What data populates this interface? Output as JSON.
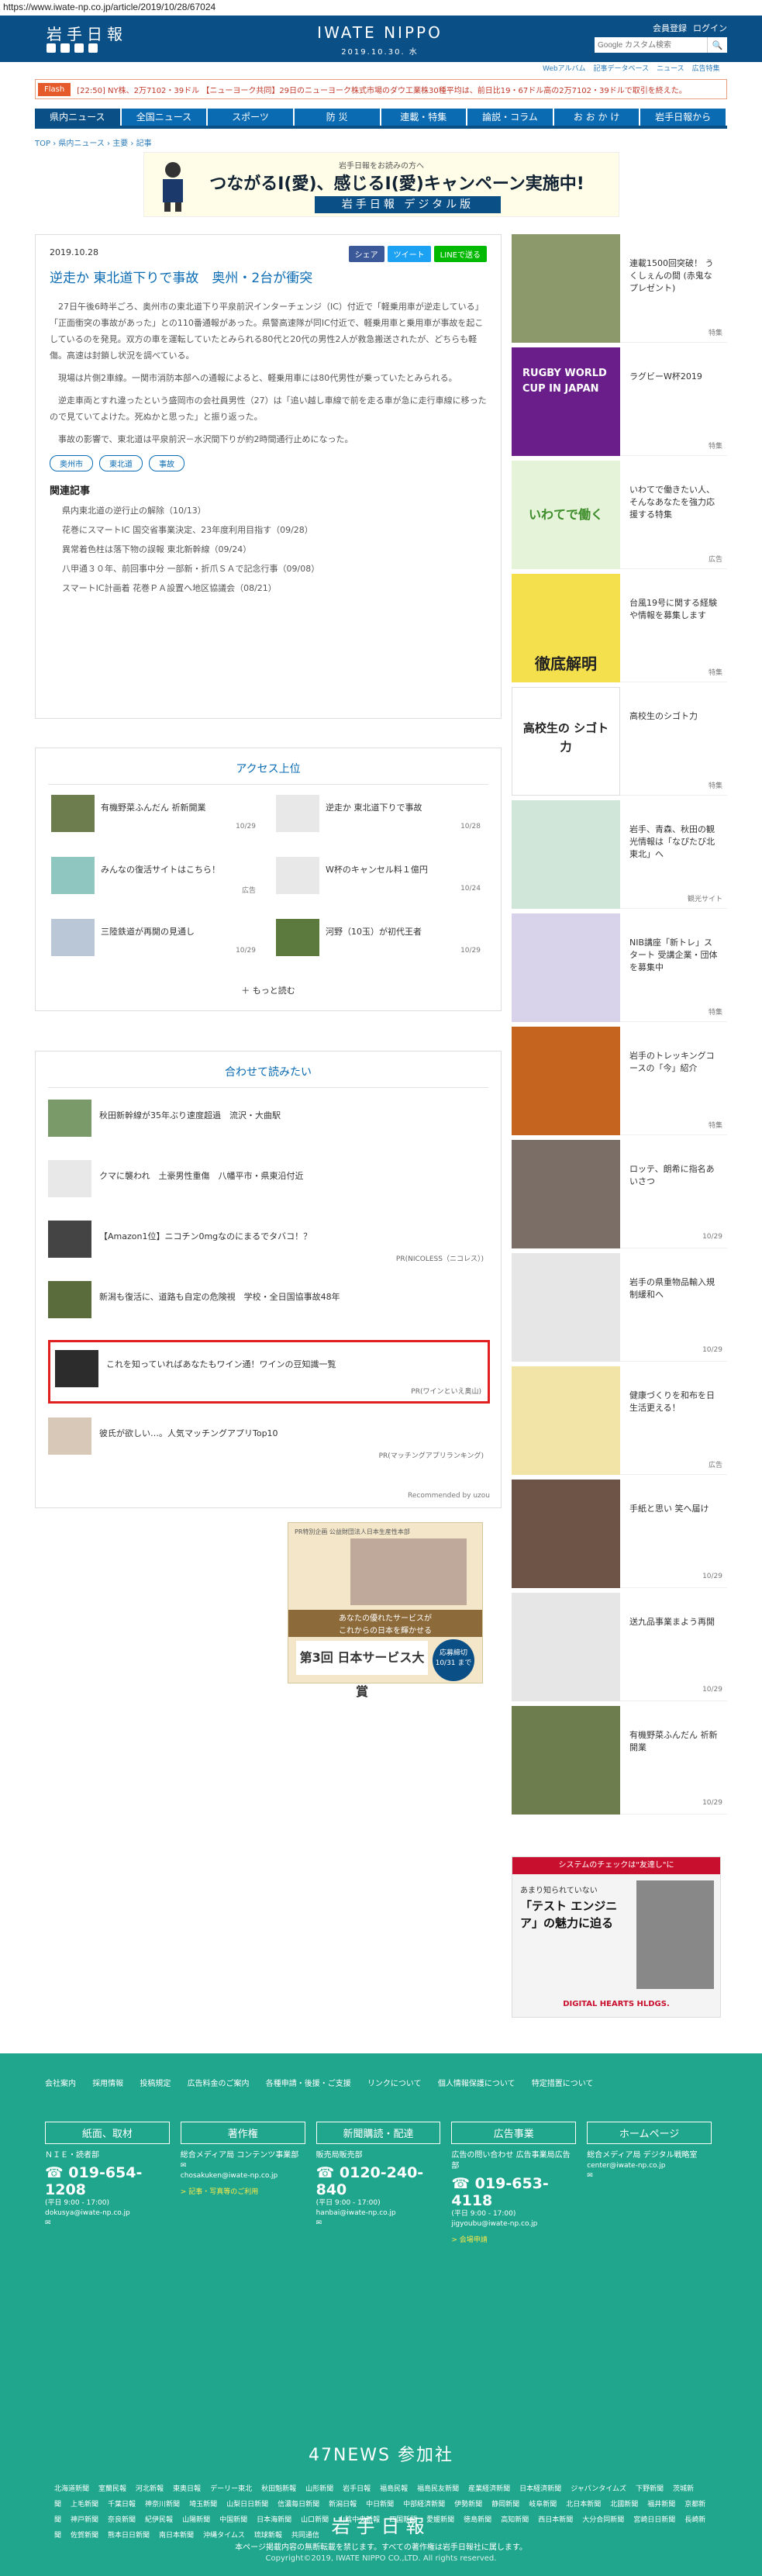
{
  "url": "https://www.iwate-np.co.jp/article/2019/10/28/67024",
  "header": {
    "logo": "岩手日報",
    "brand": "IWATE NIPPO",
    "date": "2019.10.30. 水",
    "links": [
      "会員登録",
      "ログイン"
    ],
    "search_placeholder": "Google カスタム検索",
    "sub_links": [
      "Webアルバム",
      "記事データベース",
      "ニュース",
      "広告特集"
    ]
  },
  "flash": {
    "label": "Flash",
    "text": "[22:50] NY株、2万7102・39ドル 【ニューヨーク共同】29日のニューヨーク株式市場のダウ工業株30種平均は、前日比19・67ドル高の2万7102・39ドルで取引を終えた。"
  },
  "nav": [
    "県内ニュース",
    "全国ニュース",
    "スポーツ",
    "防 災",
    "連載・特集",
    "論説・コラム",
    "お お か け",
    "岩手日報から"
  ],
  "breadcrumb": "TOP › 県内ニュース › 主要 › 記事",
  "banner": {
    "sub": "岩手日報をお読みの方へ",
    "main": "つながるI(愛)、感じるI(愛)キャンペーン実施中!",
    "logo": "岩手日報 デジタル版"
  },
  "article": {
    "date": "2019.10.28",
    "share": [
      "シェア",
      "ツイート",
      "LINEで送る"
    ],
    "title": "逆走か 東北道下りで事故　奥州・2台が衝突",
    "paragraphs": [
      "27日午後6時半ごろ、奥州市の東北道下り平泉前沢インターチェンジ（IC）付近で「軽乗用車が逆走している」「正面衝突の事故があった」との110番通報があった。県警高速隊が同IC付近で、軽乗用車と乗用車が事故を起こしているのを発見。双方の車を運転していたとみられる80代と20代の男性2人が救急搬送されたが、どちらも軽傷。高速は封鎖し状況を調べている。",
      "現場は片側2車線。一関市消防本部への通報によると、軽乗用車には80代男性が乗っていたとみられる。",
      "逆走車両とすれ違ったという盛岡市の会社員男性（27）は「追い越し車線で前を走る車が急に走行車線に移ったので見ていてよけた。死ぬかと思った」と振り返った。",
      "事故の影響で、東北道は平泉前沢－水沢間下りが約2時間通行止めになった。"
    ],
    "tags": [
      "奥州市",
      "東北道",
      "事故"
    ],
    "related_heading": "関連記事",
    "related": [
      "県内東北道の逆行止の解除（10/13）",
      "花巻にスマートIC 国交省事業決定、23年度利用目指す（09/28）",
      "異常着色柱は落下物の誤報 東北新幹線（09/24）",
      "八甲通３０年、前回事中分 一部新・折爪ＳＡで記念行事（09/08）",
      "スマートIC計画着 花巻ＰＡ設置へ地区協議会（08/21）"
    ]
  },
  "ranking": {
    "heading": "アクセス上位",
    "items": [
      {
        "title": "有機野菜ふんだん 祈新開業",
        "date": "10/29"
      },
      {
        "title": "逆走か 東北道下りで事故",
        "date": "10/28"
      },
      {
        "title": "みんなの復活サイトはこちら！",
        "date": "広告"
      },
      {
        "title": "W杯のキャンセル料１億円",
        "date": "10/24"
      },
      {
        "title": "三陸鉄道が再開の見通し",
        "date": "10/29"
      },
      {
        "title": "河野（10玉）が初代王者",
        "date": "10/29"
      }
    ],
    "more": "もっと読む"
  },
  "recommend": {
    "heading": "合わせて読みたい",
    "items": [
      {
        "title": "秋田新幹線が35年ぶり速度超過　流沢・大曲駅",
        "source": ""
      },
      {
        "title": "クマに襲われ　土豪男性重傷　八幡平市・県東沿付近",
        "source": ""
      },
      {
        "title": "【Amazon1位】ニコチン0mgなのにまるでタバコ！？",
        "source": "PR(NICOLESS（ニコレス）)"
      },
      {
        "title": "新潟も復活に、道路も自定の危険視　学校・全日国協事故48年",
        "source": ""
      },
      {
        "title": "これを知っていればあなたもワイン通！ワインの豆知識一覧",
        "source": "PR(ワインといえ奥山)"
      },
      {
        "title": "彼氏が欲しい…。人気マッチングアプリTop10",
        "source": "PR(マッチングアプリランキング)"
      }
    ],
    "powered": "Recommended by uzou"
  },
  "award_ad": {
    "tag": "PR特別企画 公益財団法人日本生産性本部",
    "text1": "あなたの優れたサービスが",
    "text2": "これからの日本を輝かせる",
    "main": "第3回 日本サービス大賞",
    "badge": "応募締切 10/31 まで"
  },
  "sidebar": [
    {
      "text": "連載1500回突破！ うくしぇんの間 (赤鬼なプレゼント)",
      "date": "特集"
    },
    {
      "text": "ラグビーW杯2019",
      "date": "特集",
      "badge": "RUGBY WORLD CUP IN JAPAN"
    },
    {
      "text": "いわてで働きたい人、そんなあなたを強力応援する特集",
      "date": "広告",
      "badge": "いわてで働く"
    },
    {
      "text": "台風19号に関する経験や情報を募集します",
      "date": "特集",
      "badge": "徹底解明"
    },
    {
      "text": "高校生のシゴト力",
      "date": "特集",
      "badge": "高校生の シゴト力"
    },
    {
      "text": "岩手、青森、秋田の観光情報は「なぴたび北東北」へ",
      "date": "観光サイト"
    },
    {
      "text": "NIB講座「新トレ」スタート 受講企業・団体を募集中",
      "date": "特集"
    },
    {
      "text": "岩手のトレッキングコースの「今」紹介",
      "date": "特集"
    },
    {
      "text": "ロッテ、朗希に指名あいさつ",
      "date": "10/29"
    },
    {
      "text": "岩手の県重物品輸入規制緩和へ",
      "date": "10/29"
    },
    {
      "text": "健康づくりを和布を日生活更える！",
      "date": "広告"
    },
    {
      "text": "手紙と思い 笑へ届け",
      "date": "10/29"
    },
    {
      "text": "送九品事業まよう再開",
      "date": "10/29"
    },
    {
      "text": "有機野菜ふんだん 祈新開業",
      "date": "10/29"
    }
  ],
  "side_ad": {
    "top": "システムのチェックは\"友達し\"に",
    "q": "あまり知られていない",
    "main": "「テスト エンジニア」の魅力に迫る",
    "logo": "DIGITAL HEARTS HLDGS."
  },
  "footer": {
    "links": [
      "会社案内",
      "採用情報",
      "投稿規定",
      "広告料金のご案内",
      "各種申請・後援・ご支援",
      "リンクについて",
      "個人情報保護について",
      "特定措置について"
    ],
    "cols": [
      {
        "heading": "紙面、取材",
        "label": "ＮＩＥ・読者部",
        "tel": "019-654-1208",
        "hours": "(平日 9:00 - 17:00)",
        "mail": "dokusya@iwate-np.co.jp",
        "link": ""
      },
      {
        "heading": "著作権",
        "label": "総合メディア局 コンテンツ事業部",
        "tel": "",
        "hours": "",
        "mail": "chosakuken@iwate-np.co.jp",
        "link": "> 記事・写真等のご利用"
      },
      {
        "heading": "新聞購読・配達",
        "label": "販売局販売部",
        "tel": "0120-240-840",
        "hours": "(平日 9:00 - 17:00)",
        "mail": "hanbai@iwate-np.co.jp",
        "link": ""
      },
      {
        "heading": "広告事業",
        "label": "広告の問い合わせ 広告事業局広告部",
        "tel": "019-653-4118",
        "hours": "(平日 9:00 - 17:00)",
        "mail": "jigyoubu@iwate-np.co.jp",
        "link": "> 会場申請"
      },
      {
        "heading": "ホームページ",
        "label": "総合メディア局 デジタル戦略室",
        "tel": "",
        "hours": "",
        "mail": "center@iwate-np.co.jp",
        "link": ""
      }
    ],
    "n47": "47NEWS 参加社",
    "papers": [
      "北海道新聞",
      "室蘭民報",
      "河北新報",
      "東奥日報",
      "デーリー東北",
      "秋田魁新報",
      "山形新聞",
      "岩手日報",
      "福島民報",
      "福島民友新聞",
      "産業経済新聞",
      "日本経済新聞",
      "ジャパンタイムズ",
      "下野新聞",
      "茨城新聞",
      "上毛新聞",
      "千葉日報",
      "神奈川新聞",
      "埼玉新聞",
      "山梨日日新聞",
      "信濃毎日新聞",
      "新潟日報",
      "中日新聞",
      "中部経済新聞",
      "伊勢新聞",
      "静岡新聞",
      "岐阜新聞",
      "北日本新聞",
      "北國新聞",
      "福井新聞",
      "京都新聞",
      "神戸新聞",
      "奈良新聞",
      "紀伊民報",
      "山陽新聞",
      "中国新聞",
      "日本海新聞",
      "山口新聞",
      "山陰中央新報",
      "四国新聞",
      "愛媛新聞",
      "徳島新聞",
      "高知新聞",
      "西日本新聞",
      "大分合同新聞",
      "宮崎日日新聞",
      "長崎新聞",
      "佐賀新聞",
      "熊本日日新聞",
      "南日本新聞",
      "沖縄タイムス",
      "琉球新報",
      "共同通信"
    ],
    "logo": "岩手日報",
    "notice": "本ページ掲載内容の無断転載を禁じます。すべての著作権は岩手日報社に属します。",
    "copyright": "Copyright©2019, IWATE NIPPO CO.,LTD. All rights reserved."
  },
  "colors": {
    "brand": "#0a4f86",
    "nav": "#0a6bb3",
    "footer": "#1fa68c",
    "flash": "#e55a2b",
    "highlight": "#e02020"
  }
}
